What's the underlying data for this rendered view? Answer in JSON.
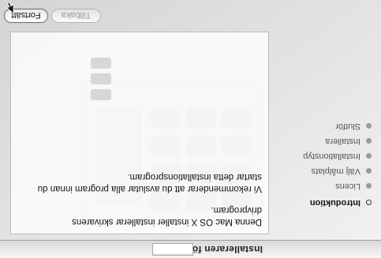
{
  "window": {
    "title": "Installeraren för"
  },
  "sidebar": {
    "items": [
      {
        "label": "Introduktion",
        "active": true
      },
      {
        "label": "Licens",
        "active": false
      },
      {
        "label": "Välj målplats",
        "active": false
      },
      {
        "label": "Installationstyp",
        "active": false
      },
      {
        "label": "Installera",
        "active": false
      },
      {
        "label": "Slutför",
        "active": false
      }
    ]
  },
  "content": {
    "paragraphs": [
      "Denna Mac OS X installer installerar skrivarens drivprogram.",
      "Vi rekommenderar att du avslutar alla program innan du startar detta installationsprogram."
    ]
  },
  "buttons": {
    "back_label": "Tillbaka",
    "continue_label": "Fortsätt"
  }
}
